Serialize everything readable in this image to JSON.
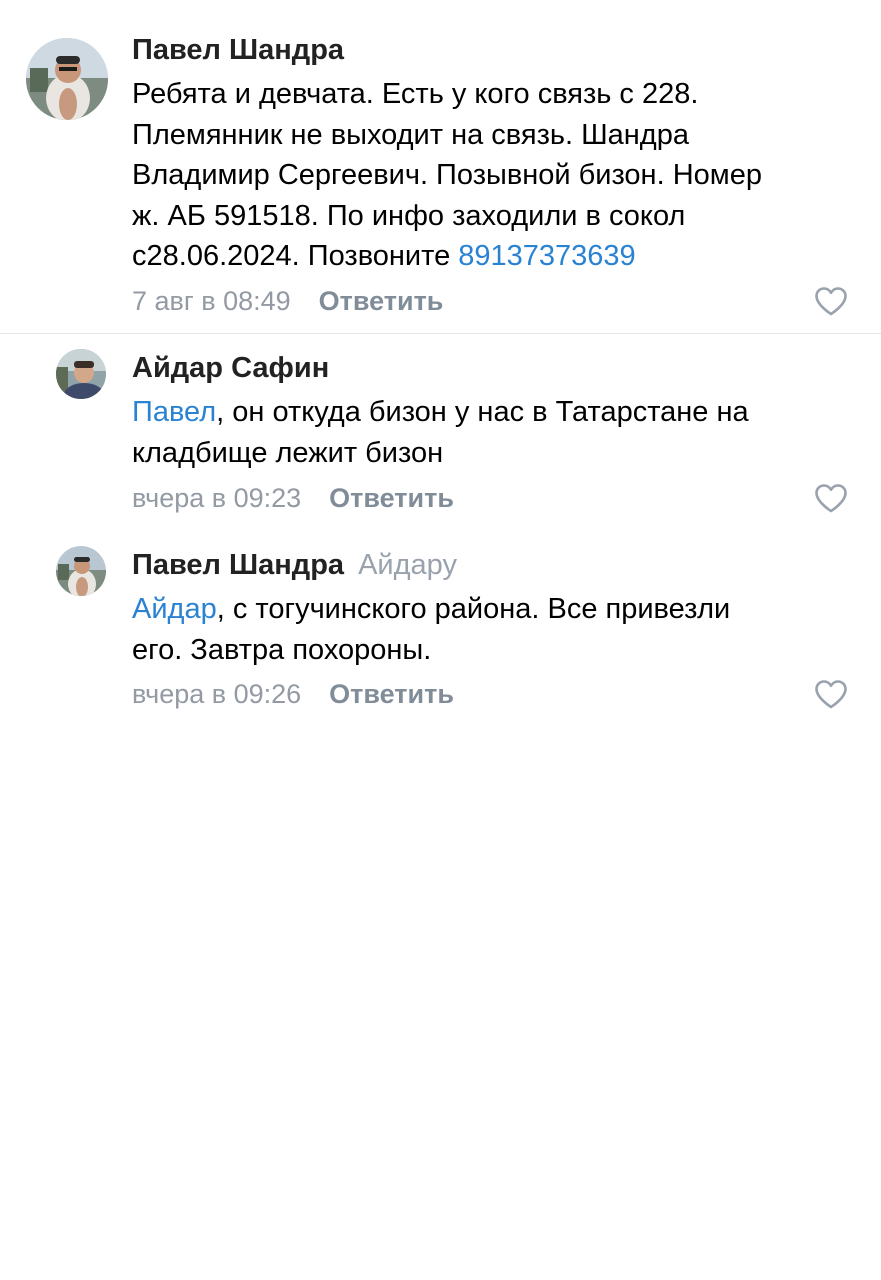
{
  "comments": [
    {
      "author": "Павел Шандра",
      "text_lines": [
        "Ребята и девчата. Есть у кого связь с 228.",
        "Племянник не выходит на связь. Шандра",
        "Владимир Сергеевич. Позывной бизон. Номер",
        "ж. АБ 591518. По инфо заходили в сокол"
      ],
      "text_last_prefix": "с28.06.2024. Позвоните ",
      "phone_link": "89137373639",
      "time": "7 авг в 08:49",
      "reply_label": "Ответить"
    },
    {
      "author": "Айдар Сафин",
      "mention": "Павел",
      "text_line1_rest": ", он откуда бизон у нас в Татарстане на",
      "text_line2": "кладбище лежит бизон",
      "time": "вчера в 09:23",
      "reply_label": "Ответить"
    },
    {
      "author": "Павел Шандра",
      "reply_to": "Айдару",
      "mention": "Айдар",
      "text_line1_rest": ", с тогучинского района. Все привезли",
      "text_line2": "его. Завтра похороны.",
      "time": "вчера в 09:26",
      "reply_label": "Ответить"
    }
  ],
  "colors": {
    "link": "#2a83d2",
    "secondary": "#99a2ad",
    "reply_button": "#818c99",
    "divider": "#e4e6e9"
  },
  "icons": {
    "like": "heart-outline-icon",
    "avatar": "user-photo"
  }
}
